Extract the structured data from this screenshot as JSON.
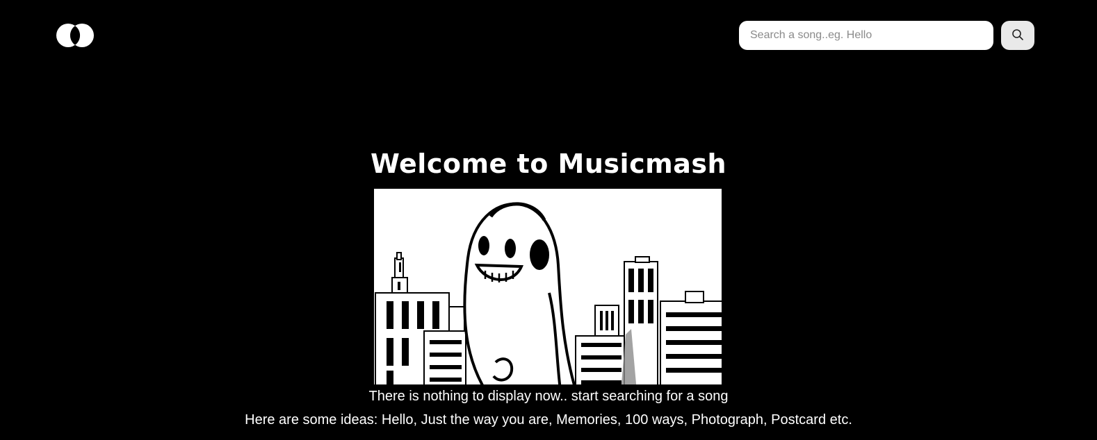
{
  "header": {
    "logo_icon": "overlapping-circles-logo-icon",
    "search": {
      "placeholder": "Search a song..eg. Hello",
      "value": "",
      "button_icon": "search-icon"
    }
  },
  "main": {
    "title": "Welcome to Musicmash",
    "hero_image": "cartoon-character-with-headphones-city-illustration",
    "empty_message": "There is nothing to display now.. start searching for a song",
    "ideas_message": "Here are some ideas: Hello, Just the way you are, Memories, 100 ways, Photograph, Postcard etc."
  },
  "colors": {
    "background": "#000000",
    "text": "#ffffff",
    "search_button_bg": "#e9e9e9"
  }
}
